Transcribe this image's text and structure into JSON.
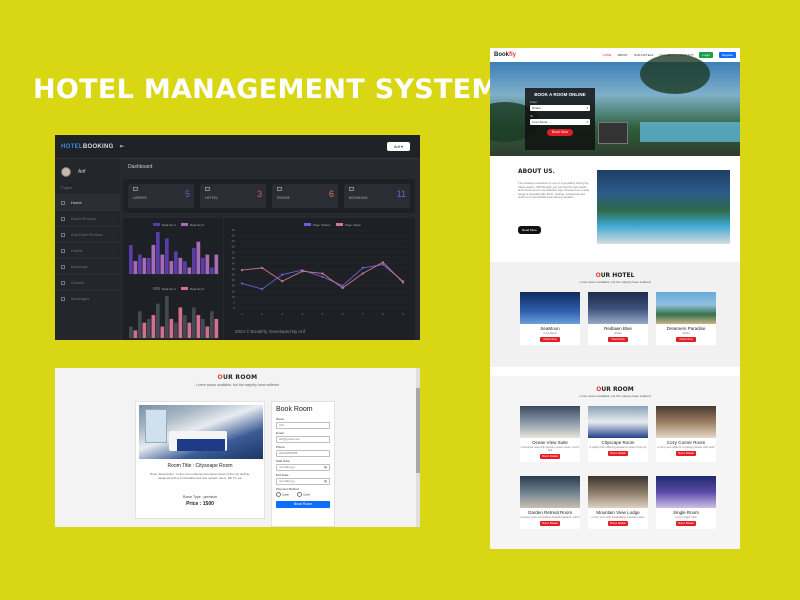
{
  "main_title": "HOTEL MANAGEMENT SYSTEM",
  "dashboard": {
    "logo_a": "HOTEL",
    "logo_b": "BOOKING",
    "toggle": "⇤",
    "user_button": "Arif ▾",
    "username": "Arif",
    "section_label": "Pages",
    "page_title": "Dashboard",
    "nav": [
      "Home",
      "Room Rooms",
      "Add Hotel Rooms",
      "Hotels",
      "Bookings",
      "Guests",
      "Messages"
    ],
    "stats": [
      {
        "label": "USERS",
        "value": "5",
        "color": "#6d5fd6"
      },
      {
        "label": "HOTEL",
        "value": "3",
        "color": "#d64f91"
      },
      {
        "label": "ROOM",
        "value": "6",
        "color": "#f0734a"
      },
      {
        "label": "BOOKING",
        "value": "11",
        "color": "#6d5fd6"
      }
    ],
    "footer": "2024 © BookFly, Developed By Arif"
  },
  "chart_data": [
    {
      "type": "bar",
      "series": [
        {
          "name": "Data Set 1",
          "values": [
            9,
            6,
            5,
            13,
            11,
            7,
            4,
            8,
            5,
            2
          ]
        },
        {
          "name": "Data Set 2",
          "values": [
            4,
            5,
            9,
            6,
            4,
            5,
            2,
            10,
            6,
            6
          ]
        }
      ],
      "colors": [
        "#5a3ea8",
        "#a86bb8"
      ],
      "legend": "top"
    },
    {
      "type": "bar",
      "series": [
        {
          "name": "Data Set 1",
          "values": [
            3,
            7,
            5,
            9,
            11,
            4,
            6,
            8,
            5,
            7
          ]
        },
        {
          "name": "Data Set 2",
          "values": [
            2,
            4,
            6,
            3,
            5,
            8,
            4,
            6,
            3,
            5
          ]
        }
      ],
      "colors": [
        "#444a54",
        "#d4708d"
      ],
      "legend": "top"
    },
    {
      "type": "line",
      "x": [
        1,
        2,
        3,
        4,
        5,
        6,
        7,
        8,
        9
      ],
      "series": [
        {
          "name": "Page Visitors",
          "values": [
            22,
            17,
            30,
            34,
            28,
            20,
            36,
            39,
            24
          ]
        },
        {
          "name": "Page Views",
          "values": [
            34,
            36,
            24,
            33,
            31,
            18,
            31,
            41,
            23
          ]
        }
      ],
      "ylim": [
        0,
        70
      ],
      "yticks": [
        0,
        5,
        10,
        15,
        20,
        25,
        30,
        35,
        40,
        45,
        50,
        55,
        60,
        65,
        70
      ],
      "colors": [
        "#6d5fd6",
        "#d07a8a"
      ],
      "legend": "top"
    }
  ],
  "booking": {
    "section_o": "O",
    "section_rest": "UR ROOM",
    "section_sub": "Lorem ipsum available, but the majority have suffered",
    "room_title": "Room Title : Citysoape Room",
    "room_desc": "Room Description : In the room offering panoramic views of the city skyline, designed with a comfortable bed and modern decor, flat TV, etc",
    "room_type": "Room Type : premium",
    "price": "Price : 1500",
    "form_title": "Book Room",
    "fields": [
      {
        "label": "Name",
        "value": "Arif"
      },
      {
        "label": "Email",
        "value": "arif@gmail.com"
      },
      {
        "label": "Phone",
        "value": "01234567895"
      },
      {
        "label": "Start Date",
        "value": "mm/dd/yyyy"
      },
      {
        "label": "End Date",
        "value": "mm/dd/yyyy"
      }
    ],
    "payment_label": "Payment Method",
    "payment_options": [
      "Cash",
      "Card"
    ],
    "book_button": "Book Room"
  },
  "site": {
    "logo_a": "Book",
    "logo_b": "fly",
    "nav": [
      "HOME",
      "ABOUT",
      "OUR HOTELS",
      "GALLERY",
      "CONTACT"
    ],
    "login": "Login",
    "register": "Register",
    "hero_title": "BOOK A ROOM ONLINE",
    "hero_from_label": "From",
    "hero_from_value": "Dhaka",
    "hero_to_label": "To",
    "hero_to_value": "Coxs Bazar",
    "hero_button": "Book Now",
    "about_title": "ABOUT US.",
    "about_text": "The package experience is one of a popularity during the travel season. With Bookfly you can find the best hotels and resorts and a cost-effective stay. Choose from a wide range of amenities like Wi-Fi, parking, restaurants and pools for a comfortable and relaxing vacation.",
    "about_button": "Read More",
    "hotel_o": "O",
    "hotel_rest": "UR HOTEL",
    "hotel_sub": "Lorem ipsum available, but the majority have suffered",
    "hotels": [
      {
        "name": "SeaMoon",
        "loc": "Coxs Bazar",
        "btn": "Check Now"
      },
      {
        "name": "Redlawn Blue",
        "loc": "Dhaka",
        "btn": "Check Now"
      },
      {
        "name": "Dreamers Paradise",
        "loc": "Sylhet",
        "btn": "Check Now"
      }
    ],
    "room_o": "O",
    "room_rest": "UR ROOM",
    "room_sub": "Lorem ipsum available, but the majority have suffered",
    "rooms": [
      {
        "name": "Ocean View Suite",
        "desc": "A luxurious suite with stunning ocean views, a cozy bed",
        "btn": "Room Details"
      },
      {
        "name": "Cityscape Room",
        "desc": "A stylish room offering panoramic views of the city",
        "btn": "Room Details"
      },
      {
        "name": "Cozy Corner Room",
        "desc": "A cozy room ideal for a relaxing retreat, with plush",
        "btn": "Room Details"
      },
      {
        "name": "Garden Retreat Room",
        "desc": "A serene room overlooking beautiful gardens, with a",
        "btn": "Room Details"
      },
      {
        "name": "Mountain View Lodge",
        "desc": "A cozy room with breathtaking mountain views",
        "btn": "Room Details"
      },
      {
        "name": "Single Room",
        "desc": "A cozy single room",
        "btn": "Room Details"
      }
    ]
  }
}
